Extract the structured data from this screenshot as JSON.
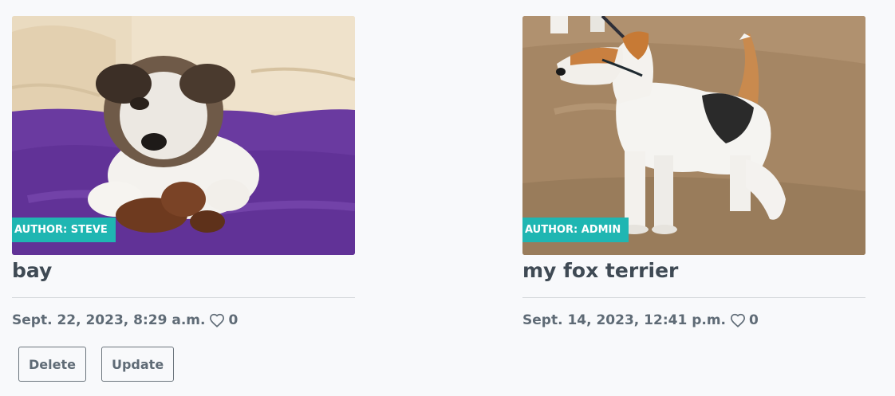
{
  "posts": [
    {
      "author_badge": "AUTHOR: STEVE",
      "title": "bay",
      "date": "Sept. 22, 2023, 8:29 a.m.",
      "likes": "0",
      "image_alt": "puppy",
      "actions": {
        "delete_label": "Delete",
        "update_label": "Update"
      }
    },
    {
      "author_badge": "AUTHOR: ADMIN",
      "title": "my fox terrier",
      "date": "Sept. 14, 2023, 12:41 p.m.",
      "likes": "0",
      "image_alt": "fox terrier"
    }
  ],
  "colors": {
    "badge": "#1fb6b2",
    "text": "#3f4a54",
    "muted": "#5f6b76",
    "background": "#f8f9fb"
  },
  "icons": {
    "like": "heart-icon"
  }
}
